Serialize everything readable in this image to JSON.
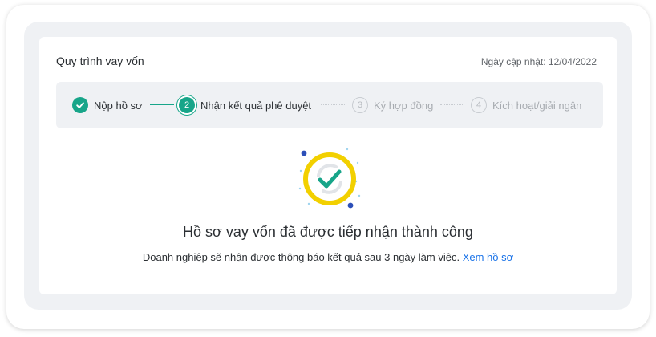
{
  "card": {
    "title": "Quy trình vay vốn",
    "updated": "Ngày cập nhật: 12/04/2022"
  },
  "steps": [
    {
      "number": "1",
      "label": "Nộp hồ sơ",
      "state": "done"
    },
    {
      "number": "2",
      "label": "Nhận kết quả phê duyệt",
      "state": "active"
    },
    {
      "number": "3",
      "label": "Ký hợp đồng",
      "state": "pending"
    },
    {
      "number": "4",
      "label": "Kích hoạt/giải ngân",
      "state": "pending"
    }
  ],
  "result": {
    "icon": "success-check-icon",
    "headline": "Hồ sơ vay vốn đã được tiếp nhận thành công",
    "message": "Doanh nghiệp sẽ nhận được thông báo kết quả sau 3 ngày làm việc.",
    "link_label": "Xem hồ sơ"
  },
  "colors": {
    "accent": "#17a589",
    "link": "#1a73e8",
    "ring": "#f2d000",
    "dots": "#2c4fb8",
    "panel": "#eff1f4"
  }
}
